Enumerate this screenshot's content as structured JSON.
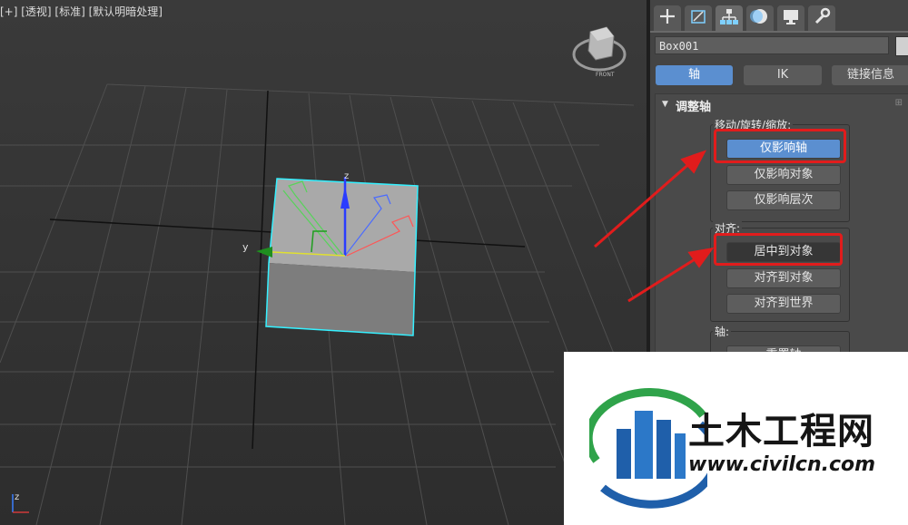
{
  "viewport": {
    "label": "[+] [透视] [标准] [默认明暗处理]",
    "axis_y_label": "y",
    "axis_z_label": "z",
    "corner_axis_label": "z",
    "viewcube_label": "FRONT"
  },
  "panel": {
    "tabs": [
      {
        "icon": "create-plus-icon"
      },
      {
        "icon": "modify-icon"
      },
      {
        "icon": "hierarchy-icon"
      },
      {
        "icon": "motion-icon"
      },
      {
        "icon": "display-icon"
      },
      {
        "icon": "utilities-wrench-icon"
      }
    ],
    "object_name": "Box001",
    "hierarchy_buttons": [
      "轴",
      "IK",
      "链接信息"
    ],
    "rollout_title": "调整轴",
    "move_group_label": "移动/旋转/缩放:",
    "move_buttons": [
      "仅影响轴",
      "仅影响对象",
      "仅影响层次"
    ],
    "align_group_label": "对齐:",
    "align_buttons": [
      "居中到对象",
      "对齐到对象",
      "对齐到世界"
    ],
    "pivot_group_label": "轴:",
    "pivot_buttons": [
      "重置轴"
    ]
  },
  "watermark": {
    "name": "土木工程网",
    "url": "www.civilcn.com"
  },
  "colors": {
    "accent": "#5b8fd0",
    "highlight_red": "#e11c1c",
    "selection_cyan": "#35f0ff"
  }
}
